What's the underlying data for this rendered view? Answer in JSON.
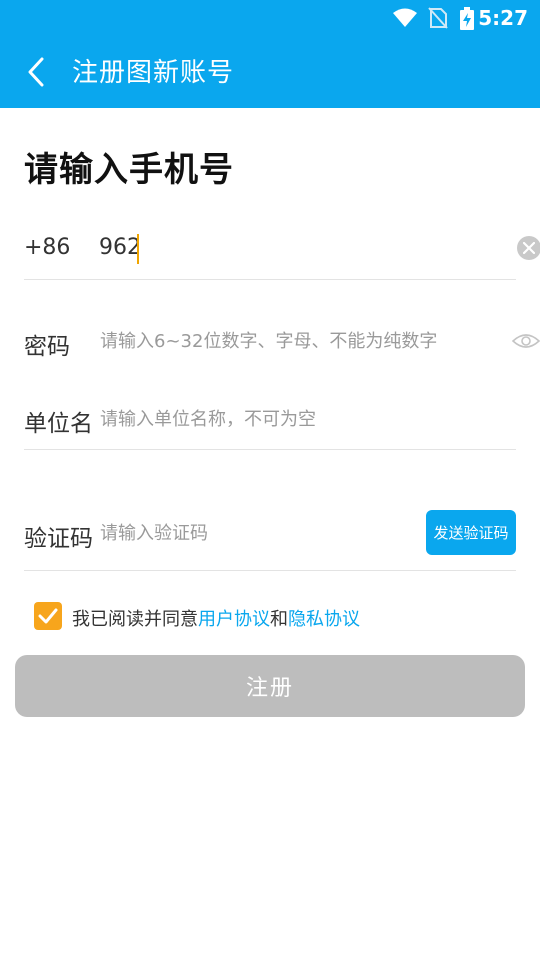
{
  "status_bar": {
    "time": "5:27"
  },
  "toolbar": {
    "title": "注册图新账号"
  },
  "heading": "请输入手机号",
  "phone": {
    "country_code": "+86",
    "value": "962"
  },
  "password": {
    "label": "密码",
    "placeholder": "请输入6~32位数字、字母、不能为纯数字"
  },
  "organization": {
    "label": "单位名",
    "placeholder": "请输入单位名称，不可为空"
  },
  "verification": {
    "label": "验证码",
    "placeholder": "请输入验证码",
    "send_label": "发送验证码"
  },
  "agreement": {
    "checked": true,
    "prefix": "我已阅读并同意",
    "user_agreement": "用户协议",
    "and": "和",
    "privacy_policy": "隐私协议"
  },
  "register_label": "注册",
  "colors": {
    "accent": "#0aa7ee",
    "checkbox": "#f7a51c",
    "disabled_button": "#bdbdbd"
  }
}
